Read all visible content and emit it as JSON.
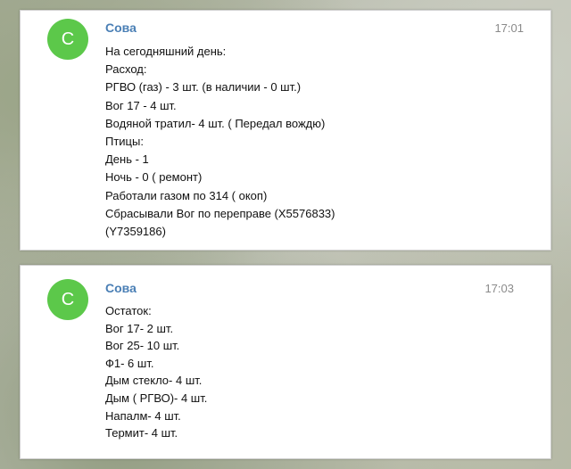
{
  "messages": [
    {
      "avatar_letter": "С",
      "sender": "Сова",
      "time": "17:01",
      "lines": [
        "На сегодняшний день:",
        "Расход:",
        "РГВО (газ) - 3 шт. (в наличии - 0 шт.)",
        "Вог 17 - 4 шт.",
        "Водяной тратил- 4 шт. ( Передал вождю)",
        "Птицы:",
        "День - 1",
        "Ночь - 0 ( ремонт)",
        "Работали газом по 314 ( окоп)",
        "Сбрасывали Вог по переправе (X5576833)",
        "(Y7359186)"
      ]
    },
    {
      "avatar_letter": "С",
      "sender": "Сова",
      "time": "17:03",
      "lines": [
        "Остаток:",
        "Вог 17- 2 шт.",
        "Вог 25- 10 шт.",
        "Ф1- 6 шт.",
        "Дым стекло- 4 шт.",
        "Дым ( РГВО)- 4 шт.",
        "Напалм- 4 шт.",
        "Термит- 4 шт."
      ]
    }
  ],
  "colors": {
    "avatar": "#5cc84a",
    "sender": "#4a7fb5",
    "time": "#8a8a8a",
    "text": "#111111"
  }
}
